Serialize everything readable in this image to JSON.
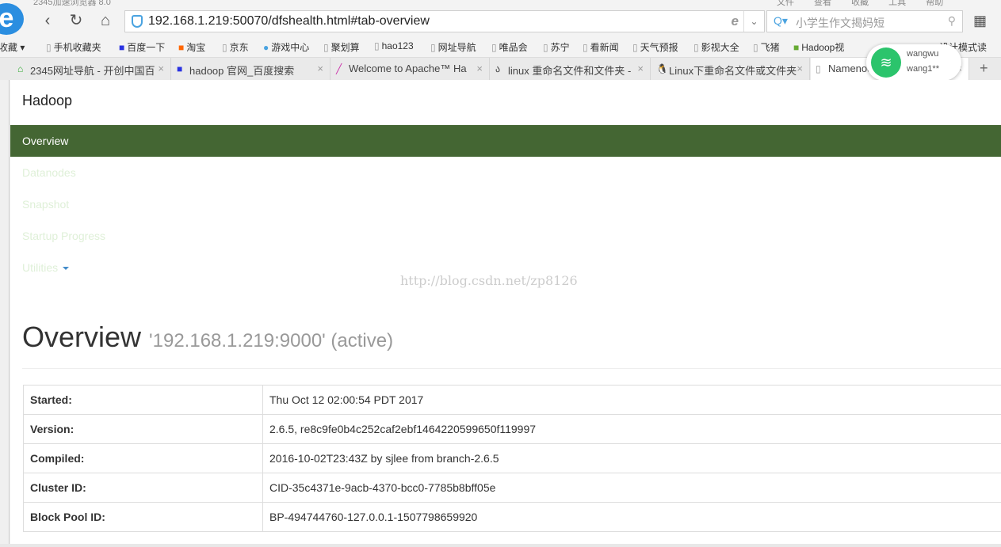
{
  "browser": {
    "title": "2345加速浏览器 8.0",
    "menu": "文件 查看 收藏 工具 帮助",
    "url": "192.168.1.219:50070/dfshealth.html#tab-overview",
    "search_placeholder": "小学生作文揭妈短"
  },
  "bookmarks": [
    "收藏",
    "手机收藏夹",
    "百度一下",
    "淘宝",
    "京东",
    "游戏中心",
    "聚划算",
    "hao123",
    "网址导航",
    "唯品会",
    "苏宁",
    "看新闻",
    "天气预报",
    "影视大全",
    "飞猪",
    "Hadoop视",
    "设计模式读"
  ],
  "tabs": [
    {
      "label": "2345网址导航 - 开创中国百"
    },
    {
      "label": "hadoop 官网_百度搜索"
    },
    {
      "label": "Welcome to Apache™ Ha"
    },
    {
      "label": "linux 重命名文件和文件夹 -"
    },
    {
      "label": "Linux下重命名文件或文件夹"
    },
    {
      "label": "Namenode"
    }
  ],
  "wifi": {
    "name": "wangwu",
    "password": "wang1**"
  },
  "page": {
    "brand": "Hadoop",
    "nav": [
      "Overview",
      "Datanodes",
      "Snapshot",
      "Startup Progress",
      "Utilities"
    ],
    "watermark": "http://blog.csdn.net/zp8126",
    "heading": "Overview",
    "subheading": "'192.168.1.219:9000' (active)",
    "rows": [
      {
        "k": "Started:",
        "v": "Thu Oct 12 02:00:54 PDT 2017"
      },
      {
        "k": "Version:",
        "v": "2.6.5, re8c9fe0b4c252caf2ebf1464220599650f119997"
      },
      {
        "k": "Compiled:",
        "v": "2016-10-02T23:43Z by sjlee from branch-2.6.5"
      },
      {
        "k": "Cluster ID:",
        "v": "CID-35c4371e-9acb-4370-bcc0-7785b8bff05e"
      },
      {
        "k": "Block Pool ID:",
        "v": "BP-494744760-127.0.0.1-1507798659920"
      }
    ]
  },
  "colors": {
    "navbar_active": "#446633",
    "nav_text": "#dff0d8"
  }
}
